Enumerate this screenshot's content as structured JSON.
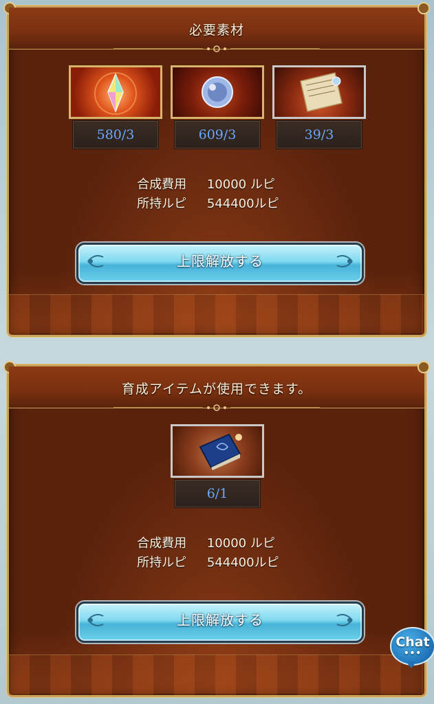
{
  "panel1": {
    "title": "必要素材",
    "items": [
      {
        "icon": "rainbow-crystal-icon",
        "count": "580/3"
      },
      {
        "icon": "crystal-orb-icon",
        "count": "609/3"
      },
      {
        "icon": "scroll-icon",
        "count": "39/3"
      }
    ],
    "cost_label": "合成費用",
    "cost_value": "10000 ルピ",
    "owned_label": "所持ルピ",
    "owned_value": "544400ルピ",
    "button_label": "上限解放する"
  },
  "panel2": {
    "title": "育成アイテムが使用できます。",
    "items": [
      {
        "icon": "blue-book-icon",
        "count": "6/1"
      }
    ],
    "cost_label": "合成費用",
    "cost_value": "10000 ルピ",
    "owned_label": "所持ルピ",
    "owned_value": "544400ルピ",
    "button_label": "上限解放する"
  },
  "chat": {
    "label": "Chat",
    "dots": "•••"
  },
  "colors": {
    "panel": "#5a220c",
    "gold_border": "#c9a25a",
    "count_text": "#6aa8ff",
    "button": "#7fd9ef"
  }
}
